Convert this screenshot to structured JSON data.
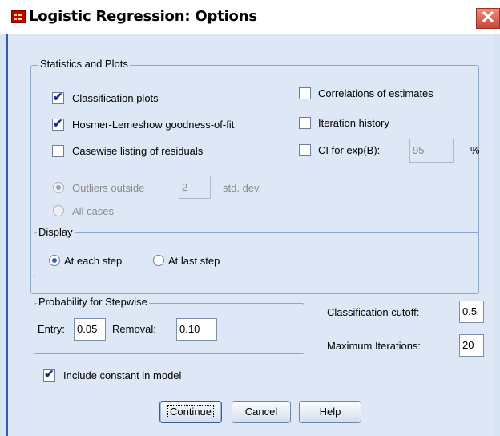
{
  "window": {
    "title": "Logistic Regression: Options",
    "close_glyph": "✕"
  },
  "stats_plots": {
    "legend": "Statistics and Plots",
    "classification_plots": {
      "label": "Classification plots",
      "checked": true
    },
    "hosmer": {
      "label": "Hosmer-Lemeshow goodness-of-fit",
      "checked": true
    },
    "casewise": {
      "label": "Casewise listing of residuals",
      "checked": false
    },
    "outliers": {
      "label": "Outliers outside",
      "value": "2",
      "suffix": "std. dev.",
      "selected": true,
      "enabled": false
    },
    "all_cases": {
      "label": "All cases",
      "selected": false,
      "enabled": false
    },
    "correlations": {
      "label": "Correlations of estimates",
      "checked": false
    },
    "iteration_history": {
      "label": "Iteration history",
      "checked": false
    },
    "ci": {
      "label": "CI for exp(B):",
      "value": "95",
      "suffix": "%",
      "checked": false
    }
  },
  "display": {
    "legend": "Display",
    "at_each_step": {
      "label": "At each step",
      "selected": true
    },
    "at_last_step": {
      "label": "At last step",
      "selected": false
    }
  },
  "stepwise": {
    "legend": "Probability for Stepwise",
    "entry_label": "Entry:",
    "entry_value": "0.05",
    "removal_label": "Removal:",
    "removal_value": "0.10"
  },
  "classification_cutoff": {
    "label": "Classification cutoff:",
    "value": "0.5"
  },
  "max_iterations": {
    "label": "Maximum Iterations:",
    "value": "20"
  },
  "include_constant": {
    "label": "Include constant in model",
    "checked": true
  },
  "buttons": {
    "continue": "Continue",
    "cancel": "Cancel",
    "help": "Help"
  }
}
